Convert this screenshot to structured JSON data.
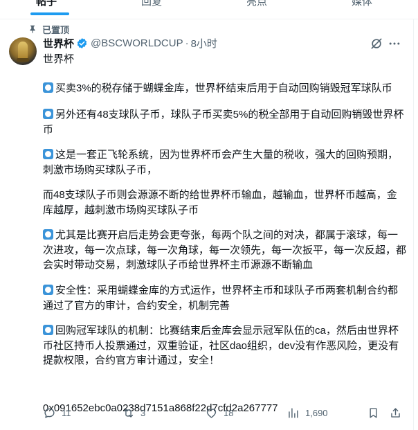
{
  "tabs": [
    {
      "label": "帖子",
      "active": true
    },
    {
      "label": "回复",
      "active": false
    },
    {
      "label": "亮点",
      "active": false
    },
    {
      "label": "媒体",
      "active": false
    }
  ],
  "pinned_label": "已置顶",
  "author": {
    "display_name": "世界杯",
    "handle": "@BSCWORLDCUP",
    "separator": "·",
    "time": "8小时"
  },
  "post": {
    "title_line": "世界杯",
    "paragraphs": [
      {
        "bullet": true,
        "text": "买卖3%的税存储于蝴蝶金库，世界杯结束后用于自动回购销毁冠军球队币"
      },
      {
        "bullet": true,
        "text": "另外还有48支球队子币，球队子币买卖5%的税全部用于自动回购销毁世界杯币"
      },
      {
        "bullet": true,
        "text": "这是一套正飞轮系统，因为世界杯币会产生大量的税收，强大的回购预期，刺激市场购买球队子币，"
      },
      {
        "bullet": false,
        "text": "而48支球队子币则会源源不断的给世界杯币输血，越输血，世界杯币越高，金库越厚，越刺激市场购买球队子币"
      },
      {
        "bullet": true,
        "text": "尤其是比赛开启后走势会更夸张，每两个队之间的对决，都属于滚球，每一次进攻，每一次点球，每一次角球，每一次领先，每一次扳平，每一次反超，都会实时带动交易，刺激球队子币给世界杯主币源源不断输血"
      },
      {
        "bullet": true,
        "text": "安全性：采用蝴蝶金库的方式运作，世界杯主币和球队子币两套机制合约都通过了官方的审计，合约安全，机制完善"
      },
      {
        "bullet": true,
        "text": "回购冠军球队的机制：比赛结束后金库会显示冠军队伍的ca，然后由世界杯币社区持币人投票通过，双重验证，社区dao组织，dev没有作恶风险，更没有提款权限，合约官方审计通过，安全！"
      }
    ],
    "contract_address": "0x091652ebc0a0238d7151a868f22d7cfd2a267777"
  },
  "actions": {
    "replies": "11",
    "reposts": "3",
    "likes": "18",
    "views": "1,690"
  },
  "colors": {
    "accent": "#1d9bf0",
    "text": "#0f1419",
    "muted": "#536471",
    "bullet": "#3b94d9"
  }
}
